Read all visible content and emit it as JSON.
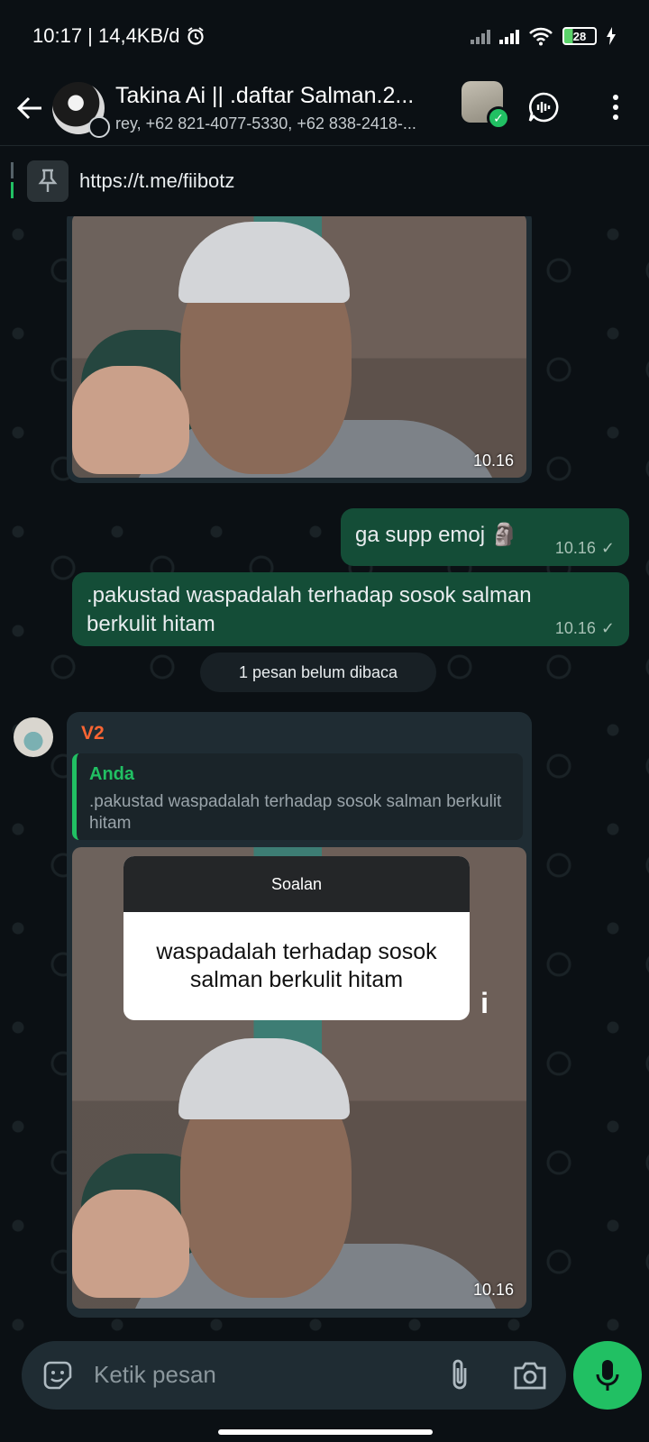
{
  "status_bar": {
    "time_speed": "10:17 | 14,4KB/d",
    "battery": "28"
  },
  "header": {
    "title": "Takina Ai || .daftar Salman.2...",
    "subtitle": "rey, +62 821-4077-5330, +62 838-2418-..."
  },
  "pinned": {
    "text": "https://t.me/fiibotz"
  },
  "messages": {
    "img1_time": "10.16",
    "out1_text": "ga supp emoj 🗿",
    "out1_time": "10.16",
    "out1_tick": "✓",
    "out2_text": ".pakustad waspadalah terhadap sosok salman berkulit hitam",
    "out2_time": "10.16",
    "out2_tick": "✓",
    "unread_label": "1 pesan belum dibaca",
    "in_sender": "V2",
    "quote_who": "Anda",
    "quote_text": ".pakustad waspadalah terhadap sosok salman berkulit hitam",
    "card_header": "Soalan",
    "card_body": "waspadalah terhadap sosok salman berkulit hitam",
    "card_info": "i",
    "img2_time": "10.16"
  },
  "composer": {
    "placeholder": "Ketik pesan"
  },
  "colors": {
    "accent": "#21c063",
    "outgoing_bubble": "#144d37",
    "incoming_bubble": "#1f2c33",
    "sender_name": "#fa6533"
  },
  "icons": [
    "back-arrow-icon",
    "voice-chat-icon",
    "more-vert-icon",
    "pin-icon",
    "emoji-icon",
    "attach-icon",
    "camera-icon",
    "mic-icon",
    "alarm-icon",
    "wifi-icon",
    "signal-icon",
    "battery-icon",
    "charging-icon"
  ]
}
